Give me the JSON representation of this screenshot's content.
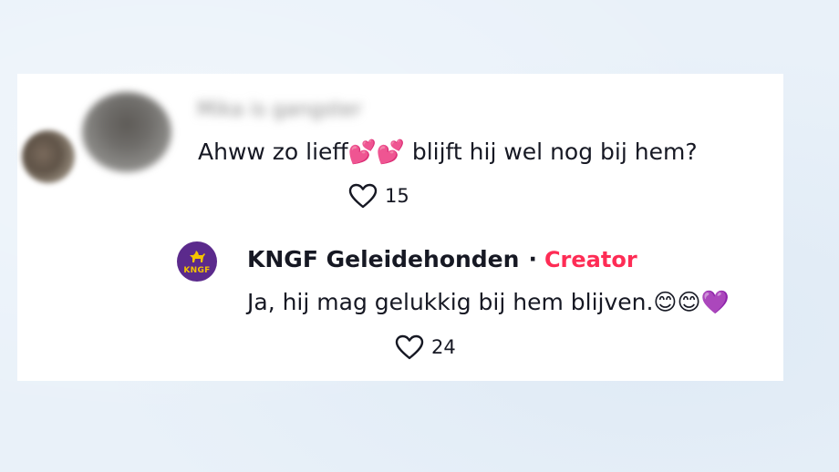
{
  "comment": {
    "username": "Mika is gangster",
    "text": "Ahww zo lieff💕💕 blijft hij wel nog bij hem?",
    "like_count": "15"
  },
  "reply": {
    "author_name": "KNGF Geleidehonden",
    "separator": "·",
    "author_badge": "Creator",
    "logo_text": "KNGF",
    "text": "Ja, hij mag gelukkig bij hem blijven.😊😊💜",
    "like_count": "24"
  },
  "colors": {
    "background": "#e9f1f9",
    "card": "#ffffff",
    "text": "#161823",
    "creator_badge": "#fe2c55",
    "logo_bg": "#5b2a8c",
    "logo_fg": "#f3c200"
  },
  "icons": {
    "like": "heart-outline-icon",
    "logo_mark": "guide-dog-icon"
  }
}
